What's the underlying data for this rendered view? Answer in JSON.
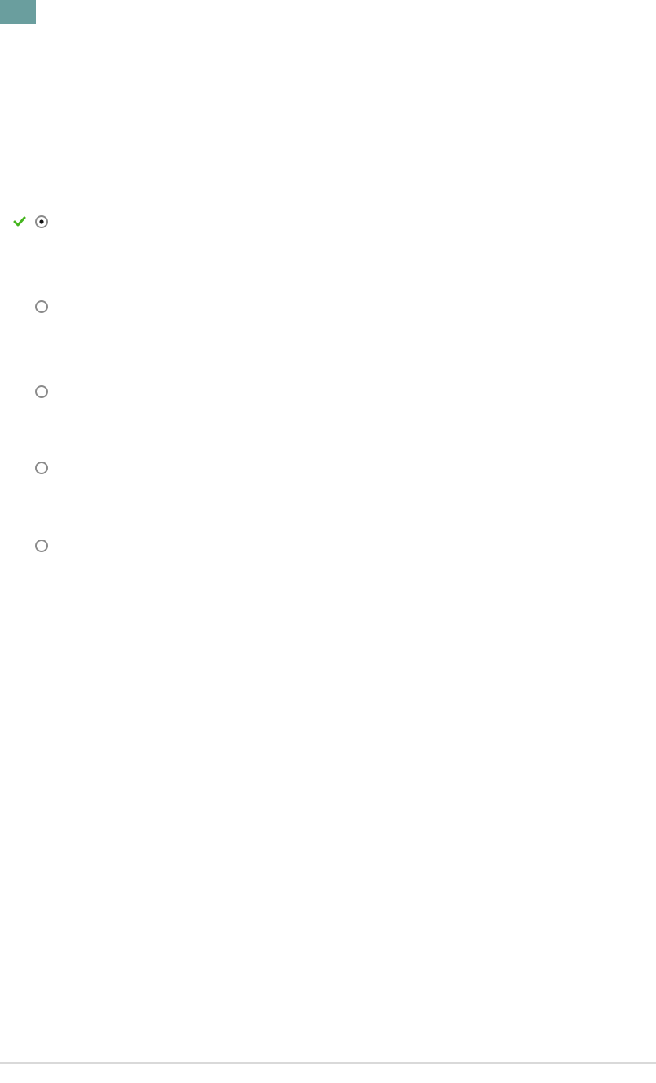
{
  "colors": {
    "corner_block": "#6a9e9e",
    "check": "#45b51e",
    "radio_ring": "#8a8a8a",
    "radio_dot": "#111111",
    "rule": "#d9d9d9"
  },
  "options": [
    {
      "label": "",
      "selected": true,
      "correct": true,
      "icon": "check-icon"
    },
    {
      "label": "",
      "selected": false,
      "correct": false
    },
    {
      "label": "",
      "selected": false,
      "correct": false
    },
    {
      "label": "",
      "selected": false,
      "correct": false
    },
    {
      "label": "",
      "selected": false,
      "correct": false
    }
  ]
}
